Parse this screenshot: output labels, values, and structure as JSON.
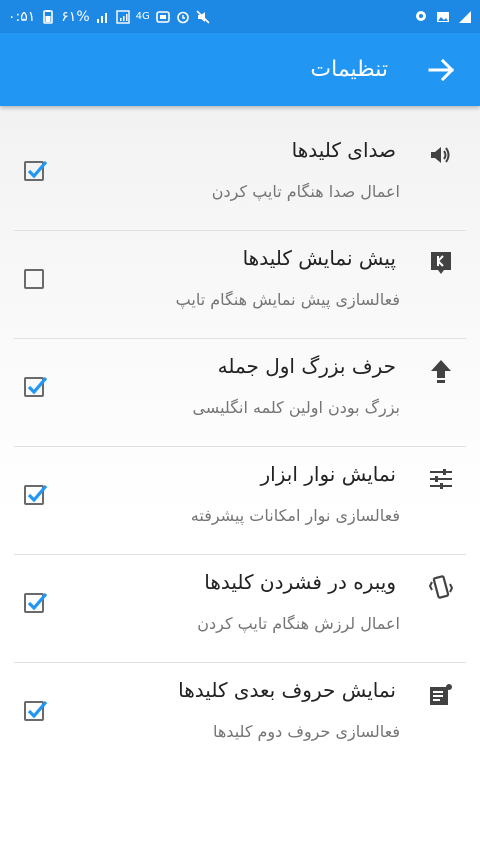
{
  "statusbar": {
    "time": "۰:۵۱",
    "battery": "۶۱%",
    "network": "4G"
  },
  "appbar": {
    "title": "تنظیمات",
    "back_icon": "arrow-right-icon"
  },
  "colors": {
    "primary": "#2196f3",
    "primary_dark": "#1e88e5",
    "checkbox_accent": "#2196f3"
  },
  "settings": [
    {
      "title": "صدای کلیدها",
      "summary": "اعمال صدا هنگام تایپ کردن",
      "icon": "speaker-icon",
      "checked": true
    },
    {
      "title": "پیش نمایش کلیدها",
      "summary": "فعالسازی پیش نمایش هنگام تایپ",
      "icon": "key-preview-icon",
      "checked": false
    },
    {
      "title": "حرف بزرگ اول جمله",
      "summary": "بزرگ بودن اولین کلمه انگلیسی",
      "icon": "arrow-up-icon",
      "checked": true
    },
    {
      "title": "نمایش نوار ابزار",
      "summary": "فعالسازی نوار امکانات پیشرفته",
      "icon": "sliders-icon",
      "checked": true
    },
    {
      "title": "ویبره در فشردن کلیدها",
      "summary": "اعمال لرزش هنگام تایپ کردن",
      "icon": "vibrate-icon",
      "checked": true
    },
    {
      "title": "نمایش حروف بعدی کلیدها",
      "summary": "فعالسازی حروف دوم کلیدها",
      "icon": "note-icon",
      "checked": true
    }
  ]
}
